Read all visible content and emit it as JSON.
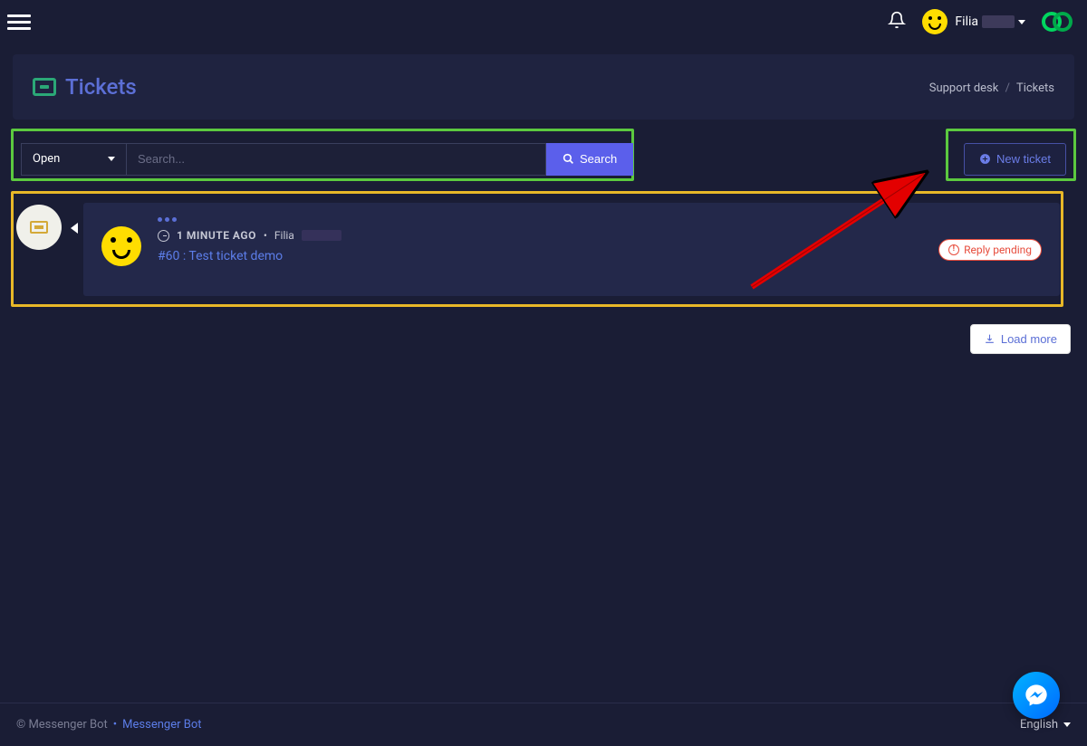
{
  "header": {
    "user_name": "Filia"
  },
  "page": {
    "title": "Tickets"
  },
  "breadcrumb": {
    "parent": "Support desk",
    "current": "Tickets"
  },
  "filter": {
    "status_selected": "Open",
    "search_placeholder": "Search...",
    "search_button": "Search"
  },
  "actions": {
    "new_ticket": "New ticket",
    "load_more": "Load more"
  },
  "ticket": {
    "time_ago": "1 MINUTE AGO",
    "author": "Filia",
    "link_text": "#60 : Test ticket demo",
    "status_badge": "Reply pending"
  },
  "footer": {
    "copyright": "© Messenger Bot",
    "link": "Messenger Bot",
    "language": "English"
  }
}
